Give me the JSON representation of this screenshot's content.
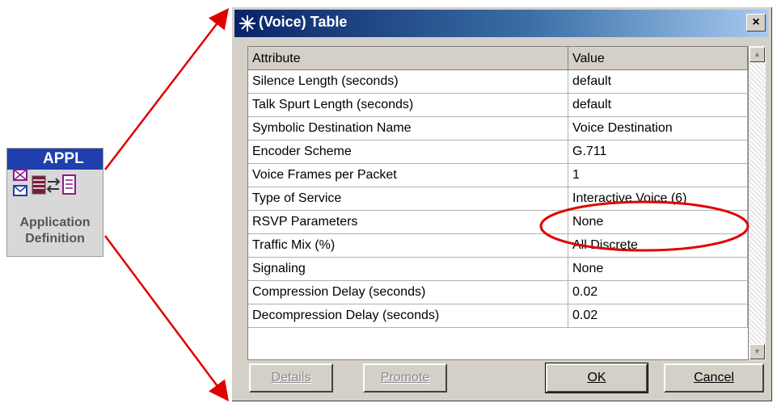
{
  "node_icon": {
    "code": "APPL",
    "name_line1": "Application",
    "name_line2": "Definition",
    "icon_names": [
      "envelope-icon",
      "database-icon",
      "transfer-icon",
      "document-icon"
    ]
  },
  "dialog": {
    "title": "(Voice) Table",
    "close_glyph": "×",
    "columns": [
      "Attribute",
      "Value"
    ],
    "rows": [
      {
        "attribute": "Silence Length (seconds)",
        "value": "default"
      },
      {
        "attribute": "Talk Spurt Length (seconds)",
        "value": "default"
      },
      {
        "attribute": "Symbolic Destination Name",
        "value": "Voice Destination"
      },
      {
        "attribute": "Encoder Scheme",
        "value": "G.711"
      },
      {
        "attribute": "Voice Frames per Packet",
        "value": "1"
      },
      {
        "attribute": "Type of Service",
        "value": "Interactive Voice (6)",
        "highlighted": true
      },
      {
        "attribute": "RSVP Parameters",
        "value": "None"
      },
      {
        "attribute": "Traffic Mix (%)",
        "value": "All Discrete"
      },
      {
        "attribute": "Signaling",
        "value": "None"
      },
      {
        "attribute": "Compression Delay (seconds)",
        "value": "0.02"
      },
      {
        "attribute": "Decompression Delay (seconds)",
        "value": "0.02"
      }
    ],
    "buttons": {
      "details": "Details",
      "promote": "Promote",
      "ok": "OK",
      "cancel": "Cancel"
    }
  },
  "colors": {
    "highlight_ellipse": "#e00000",
    "arrow": "#e00000",
    "title_bar": "#0a246a"
  }
}
